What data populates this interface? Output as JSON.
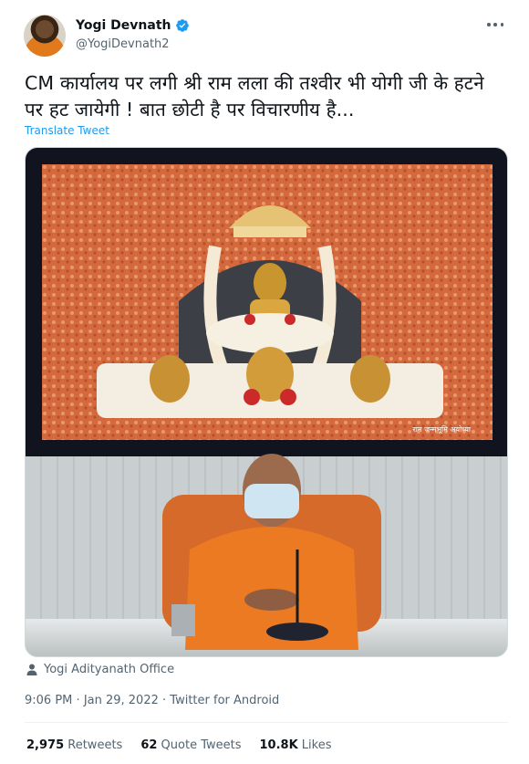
{
  "author": {
    "name": "Yogi Devnath",
    "handle": "@YogiDevnath2",
    "verified": true,
    "avatar_icon": "avatar-icon",
    "more_icon": "more-options-icon"
  },
  "tweet": {
    "text_line1": "CM कार्यालय पर लगी श्री राम लला की तश्वीर भी योगी जी के हटने",
    "text_line2": "पर हट जायेगी ! बात छोटी है पर विचारणीय है...",
    "translate_label": "Translate Tweet"
  },
  "media": {
    "screen_watermark": "राम जन्मभूमि अयोध्या"
  },
  "location": {
    "icon": "person-icon",
    "label": "Yogi Adityanath Office"
  },
  "meta": {
    "time": "9:06 PM",
    "date": "Jan 29, 2022",
    "source": "Twitter for Android",
    "separator": "·"
  },
  "stats": {
    "retweets_count": "2,975",
    "retweets_label": "Retweets",
    "quotes_count": "62",
    "quotes_label": "Quote Tweets",
    "likes_count": "10.8K",
    "likes_label": "Likes"
  },
  "colors": {
    "accent": "#1d9bf0",
    "secondary_text": "#536471",
    "primary_text": "#0f1419"
  }
}
